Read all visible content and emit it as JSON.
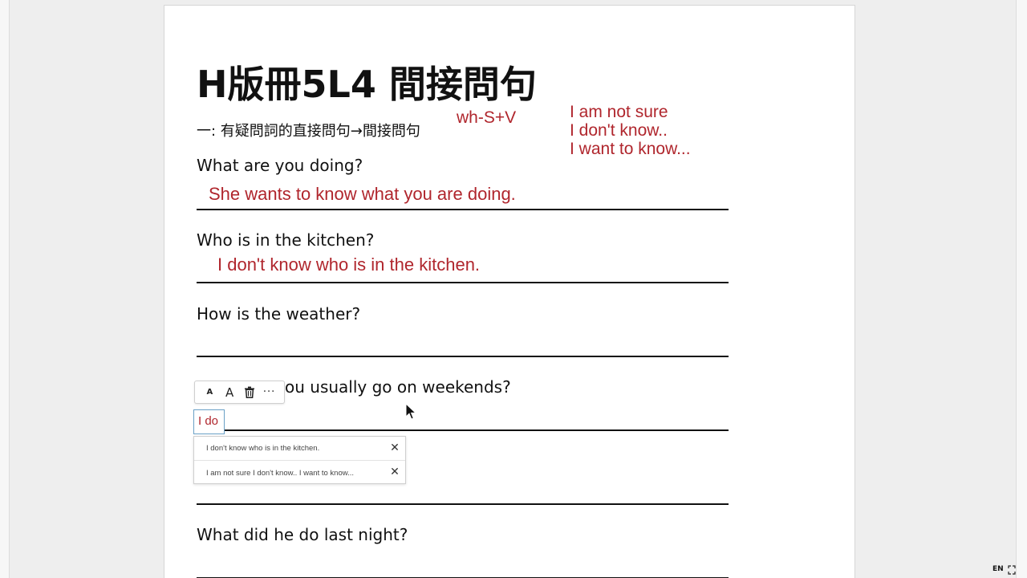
{
  "document": {
    "title": "H版冊5L4 間接問句",
    "subtitle": "一: 有疑問詞的直接問句→間接問句",
    "hint_wh": "wh-S+V",
    "hint_phrases": [
      "I am not sure",
      "I don't know..",
      "I want to know..."
    ]
  },
  "questions": [
    {
      "text": "What are you doing?",
      "answer": "She wants to know what you are doing."
    },
    {
      "text": "Who is in the kitchen?",
      "answer": "I don't know who is in the kitchen."
    },
    {
      "text": "How is the weather?",
      "answer": ""
    },
    {
      "text": "ou usually go on weekends?",
      "answer": ""
    },
    {
      "text": "",
      "answer": ""
    },
    {
      "text": "What did he do last night?",
      "answer": ""
    }
  ],
  "toolbar": {
    "small_font_label": "A",
    "large_font_label": "A",
    "delete_icon": "trash-icon",
    "more_label": "···"
  },
  "text_input": {
    "value": "I do"
  },
  "suggestions": [
    {
      "text": "I don't know who is in the kitchen.",
      "close": "✕"
    },
    {
      "text": "I am not sure I don't know.. I want to know...",
      "close": "✕"
    }
  ],
  "status": {
    "language": "EN"
  },
  "colors": {
    "annotation_red": "#b0262d",
    "input_border": "#6aa1c6"
  }
}
